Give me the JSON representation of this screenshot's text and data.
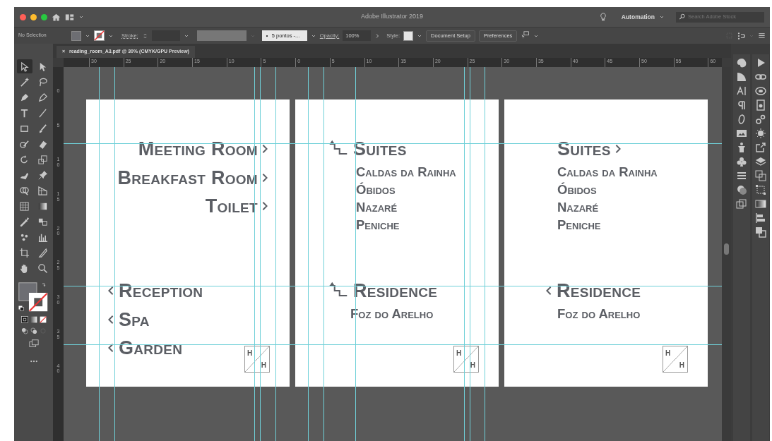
{
  "window": {
    "title": "Adobe Illustrator 2019"
  },
  "title_bar": {
    "workspace": "Automation",
    "search": {
      "placeholder": "Search Adobe Stock"
    }
  },
  "control_bar": {
    "selection": "No Selection",
    "stroke_label": "Stroke:",
    "brush": "5 pontos -...",
    "opacity_label": "Opacity:",
    "opacity": "100%",
    "style_label": "Style:",
    "buttons": [
      "Document Setup",
      "Preferences"
    ]
  },
  "document_tab": {
    "close": "×",
    "title": "reading_room_A3.pdf @ 30% (CMYK/GPU Preview)"
  },
  "ruler": {
    "horizontal": [
      "30",
      "25",
      "20",
      "15",
      "10",
      "5",
      "0",
      "5",
      "10",
      "15",
      "20",
      "25",
      "30",
      "35",
      "40",
      "45",
      "50",
      "55",
      "60"
    ],
    "vertical": [
      "0",
      "5",
      "10",
      "15",
      "20",
      "25",
      "30",
      "35",
      "40"
    ]
  },
  "artboards": [
    {
      "sections": [
        {
          "kind": "right",
          "entries": [
            {
              "text": "Meeting Room",
              "kind": "heading",
              "arrow": {
                "kind": "right"
              }
            },
            {
              "text": "Breakfast Room",
              "kind": "heading",
              "arrow": {
                "kind": "right"
              }
            },
            {
              "text": "Toilet",
              "kind": "heading",
              "arrow": {
                "kind": "right"
              }
            }
          ]
        },
        {
          "kind": "left",
          "entries": [
            {
              "text": "Reception",
              "kind": "heading",
              "arrow": {
                "kind": "left"
              }
            },
            {
              "text": "Spa",
              "kind": "heading",
              "arrow": {
                "kind": "left"
              }
            },
            {
              "text": "Garden",
              "kind": "heading",
              "arrow": {
                "kind": "left"
              }
            }
          ]
        }
      ],
      "logo": {
        "top": "H",
        "bottom": "H"
      }
    },
    {
      "sections": [
        {
          "kind": "left",
          "entries": [
            {
              "text": "Suites",
              "kind": "heading",
              "arrow": {
                "kind": "stairs"
              }
            },
            {
              "text": "Caldas da Rainha",
              "kind": "sub"
            },
            {
              "text": "Óbidos",
              "kind": "sub"
            },
            {
              "text": "Nazaré",
              "kind": "sub"
            },
            {
              "text": "Peniche",
              "kind": "sub"
            }
          ]
        },
        {
          "kind": "left",
          "entries": [
            {
              "text": "Residence",
              "kind": "heading",
              "arrow": {
                "kind": "stairs"
              }
            },
            {
              "text": "Foz do Arelho",
              "kind": "sub"
            }
          ]
        }
      ],
      "logo": {
        "top": "H",
        "bottom": "H"
      }
    },
    {
      "sections": [
        {
          "kind": "left",
          "entries": [
            {
              "text": "Suites",
              "kind": "heading",
              "arrow": {
                "kind": "right"
              }
            },
            {
              "text": "Caldas da Rainha",
              "kind": "sub"
            },
            {
              "text": "Óbidos",
              "kind": "sub"
            },
            {
              "text": "Nazaré",
              "kind": "sub"
            },
            {
              "text": "Peniche",
              "kind": "sub"
            }
          ]
        },
        {
          "kind": "left",
          "entries": [
            {
              "text": "Residence",
              "kind": "heading",
              "arrow": {
                "kind": "left"
              }
            },
            {
              "text": "Foz do Arelho",
              "kind": "sub"
            }
          ]
        }
      ],
      "logo": {
        "top": "H",
        "bottom": "H"
      }
    }
  ]
}
